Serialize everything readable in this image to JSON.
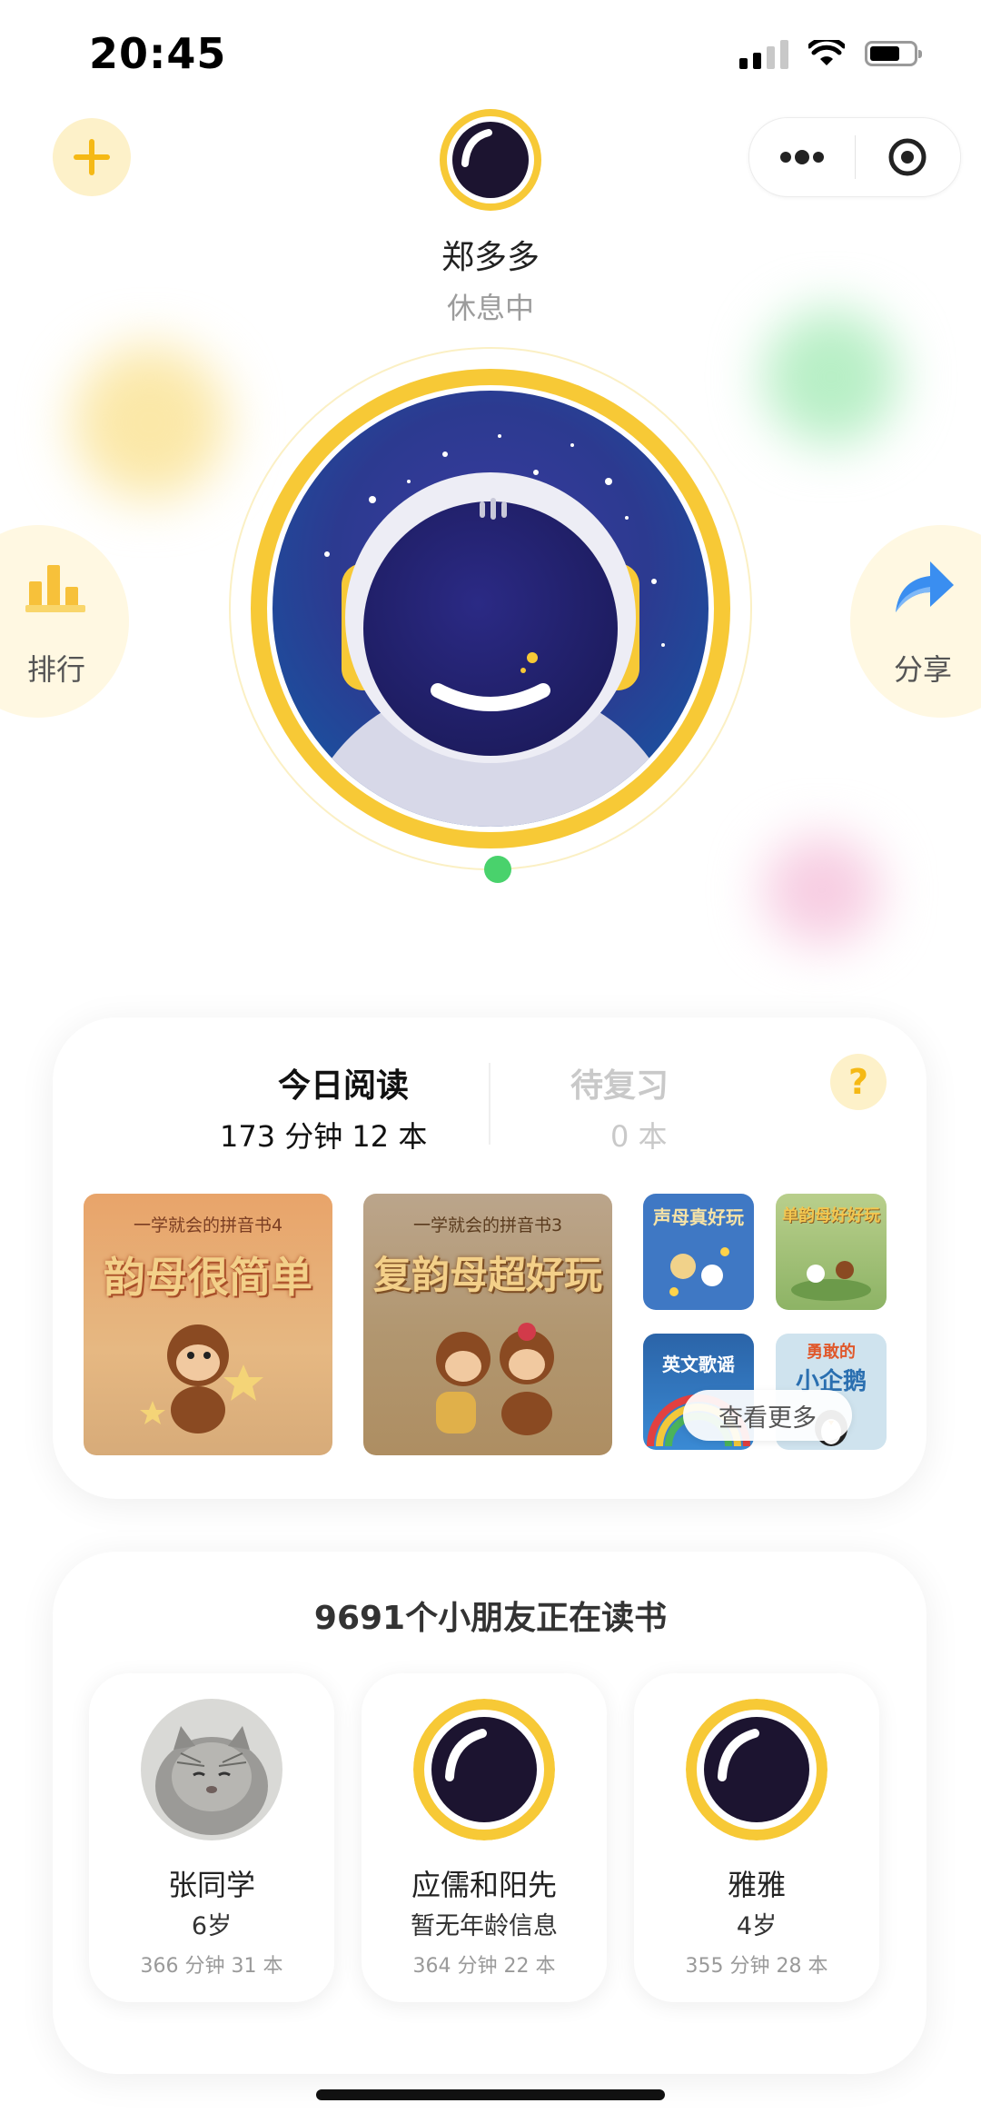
{
  "status_bar": {
    "time": "20:45"
  },
  "header": {
    "user_name": "郑多多",
    "user_status": "休息中"
  },
  "side": {
    "rank_label": "排行",
    "share_label": "分享"
  },
  "today": {
    "label": "今日阅读",
    "stats": "173 分钟 12 本",
    "review_label": "待复习",
    "review_stats": "0 本",
    "help": "?",
    "more_button": "查看更多",
    "books": [
      {
        "title": "韵母很简单",
        "series": "一学就会的拼音书4"
      },
      {
        "title": "复韵母超好玩",
        "series": "一学就会的拼音书3"
      },
      {
        "title": "声母真好玩"
      },
      {
        "title": "单韵母好好玩"
      },
      {
        "title": "英文歌谣"
      },
      {
        "title": "小企鹅",
        "subtitle": "勇敢的"
      }
    ]
  },
  "readers": {
    "title": "9691个小朋友正在读书",
    "items": [
      {
        "name": "张同学",
        "age": "6岁",
        "stats": "366 分钟 31 本"
      },
      {
        "name": "应儒和阳先",
        "age": "暂无年龄信息",
        "stats": "364 分钟 22 本"
      },
      {
        "name": "雅雅",
        "age": "4岁",
        "stats": "355 分钟 28 本"
      }
    ]
  },
  "colors": {
    "accent": "#f7c936",
    "accent_soft": "#fdf1c9",
    "online": "#49d26c",
    "share_blue": "#3a8ef0"
  }
}
